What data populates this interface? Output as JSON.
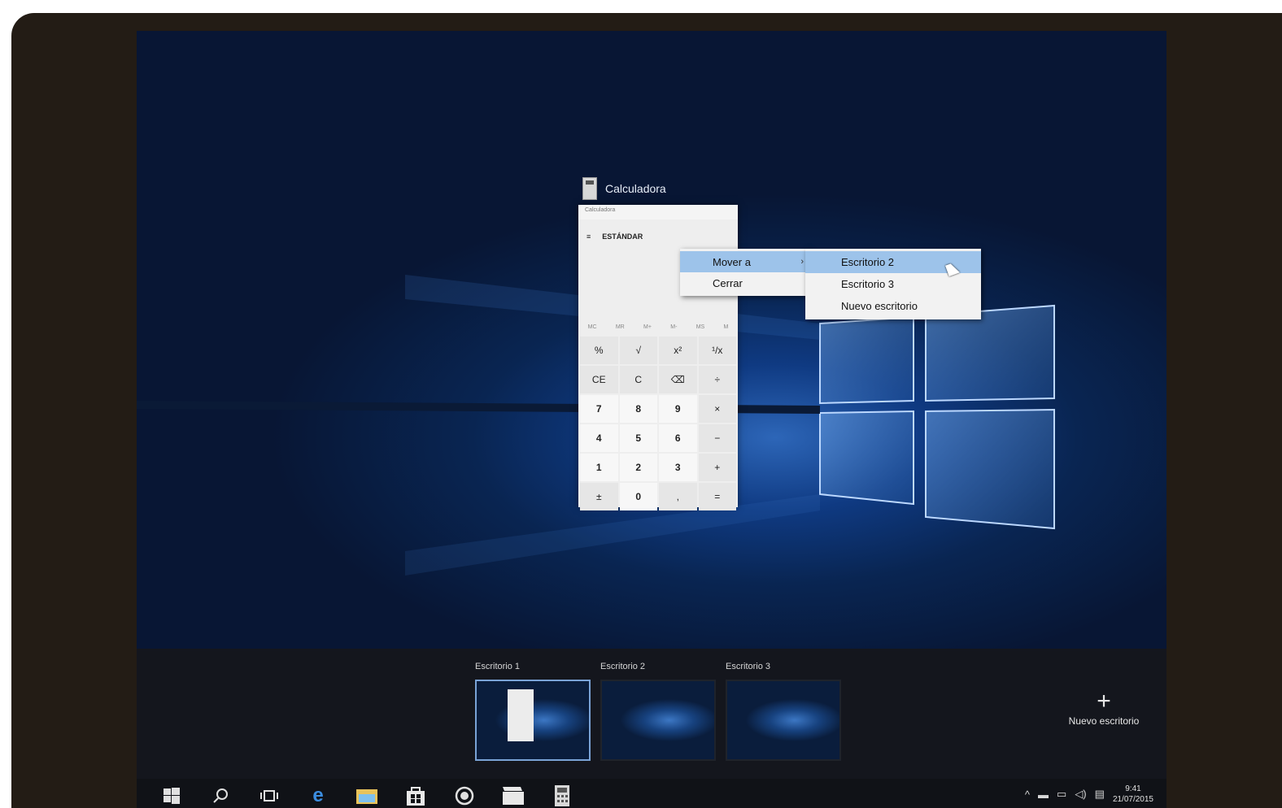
{
  "window": {
    "title": "Calculadora",
    "tb_text": "Calculadora",
    "mode": "ESTÁNDAR",
    "memory_keys": [
      "MC",
      "MR",
      "M+",
      "M-",
      "MS",
      "M"
    ],
    "keys": [
      "%",
      "√",
      "x²",
      "¹/x",
      "CE",
      "C",
      "⌫",
      "÷",
      "7",
      "8",
      "9",
      "×",
      "4",
      "5",
      "6",
      "−",
      "1",
      "2",
      "3",
      "+",
      "±",
      "0",
      ",",
      "="
    ]
  },
  "context_menu": {
    "items": [
      {
        "label": "Mover a",
        "selected": true,
        "has_submenu": true
      },
      {
        "label": "Cerrar",
        "selected": false,
        "has_submenu": false
      }
    ],
    "submenu": [
      {
        "label": "Escritorio 2",
        "selected": true
      },
      {
        "label": "Escritorio 3",
        "selected": false
      },
      {
        "label": "Nuevo escritorio",
        "selected": false
      }
    ]
  },
  "task_view": {
    "desktops": [
      {
        "label": "Escritorio 1",
        "active": true
      },
      {
        "label": "Escritorio 2",
        "active": false
      },
      {
        "label": "Escritorio 3",
        "active": false
      }
    ],
    "new_desktop_label": "Nuevo escritorio"
  },
  "taskbar": {
    "icons": [
      "windows-start-icon",
      "search-icon",
      "task-view-icon",
      "edge-icon",
      "file-explorer-icon",
      "store-icon",
      "media-player-icon",
      "movies-icon",
      "calculator-icon"
    ],
    "time": "9:41",
    "date": "21/07/2015"
  },
  "colors": {
    "accent": "#9dc3ea",
    "frame": "#231c15",
    "taskbar": "#101217"
  }
}
